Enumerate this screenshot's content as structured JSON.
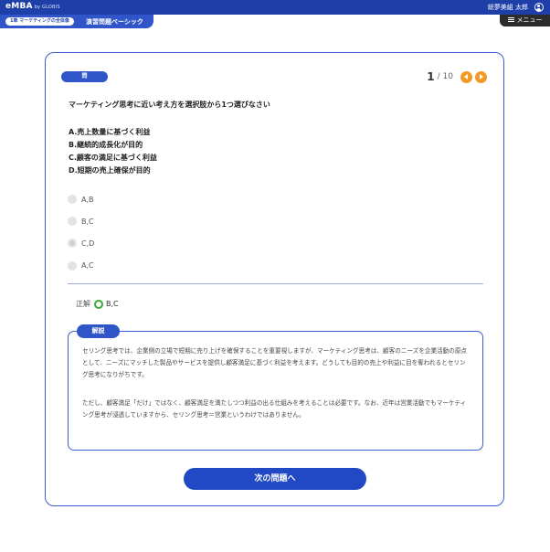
{
  "header": {
    "logo_main": "eMBA",
    "logo_sub": "by GLOBIS",
    "user_name": "総夢美組 太郎"
  },
  "breadcrumb": {
    "chapter": "1章 マーケティングの全体像",
    "title": "演習問題ベーシック"
  },
  "menu": {
    "label": "メニュー"
  },
  "quiz": {
    "badge": "問",
    "current": "1",
    "total": "/ 10",
    "question": "マーケティング思考に近い考え方を選択肢から1つ選びなさい",
    "statements": [
      "A.売上数量に基づく利益",
      "B.継続的成長化が目的",
      "C.顧客の満足に基づく利益",
      "D.短期の売上確保が目的"
    ],
    "choices": [
      "A,B",
      "B,C",
      "C,D",
      "A,C"
    ],
    "selected_index": 2,
    "answer_label": "正解",
    "answer_value": "B,C"
  },
  "explanation": {
    "tab": "解説",
    "paragraph1": "セリング思考では、企業側の立場で短期に売り上げを確保することを重要視しますが、マーケティング思考は、顧客のニーズを企業活動の原点として、ニーズにマッチした製品やサービスを提供し顧客満足に基づく利益を考えます。どうしても目的の売上や利益に目を奪われるとセリング思考になりがちです。",
    "paragraph2": "ただし、顧客満足「だけ」ではなく、顧客満足を満たしつつ利益の出る仕組みを考えることは必要です。なお、近年は営業活動でもマーケティング思考が浸透していますから、セリング思考＝営業というわけではありません。"
  },
  "next_button": "次の問題へ",
  "colors": {
    "primary": "#2148c5",
    "accent": "#f39a26",
    "correct": "#3aaa35"
  }
}
